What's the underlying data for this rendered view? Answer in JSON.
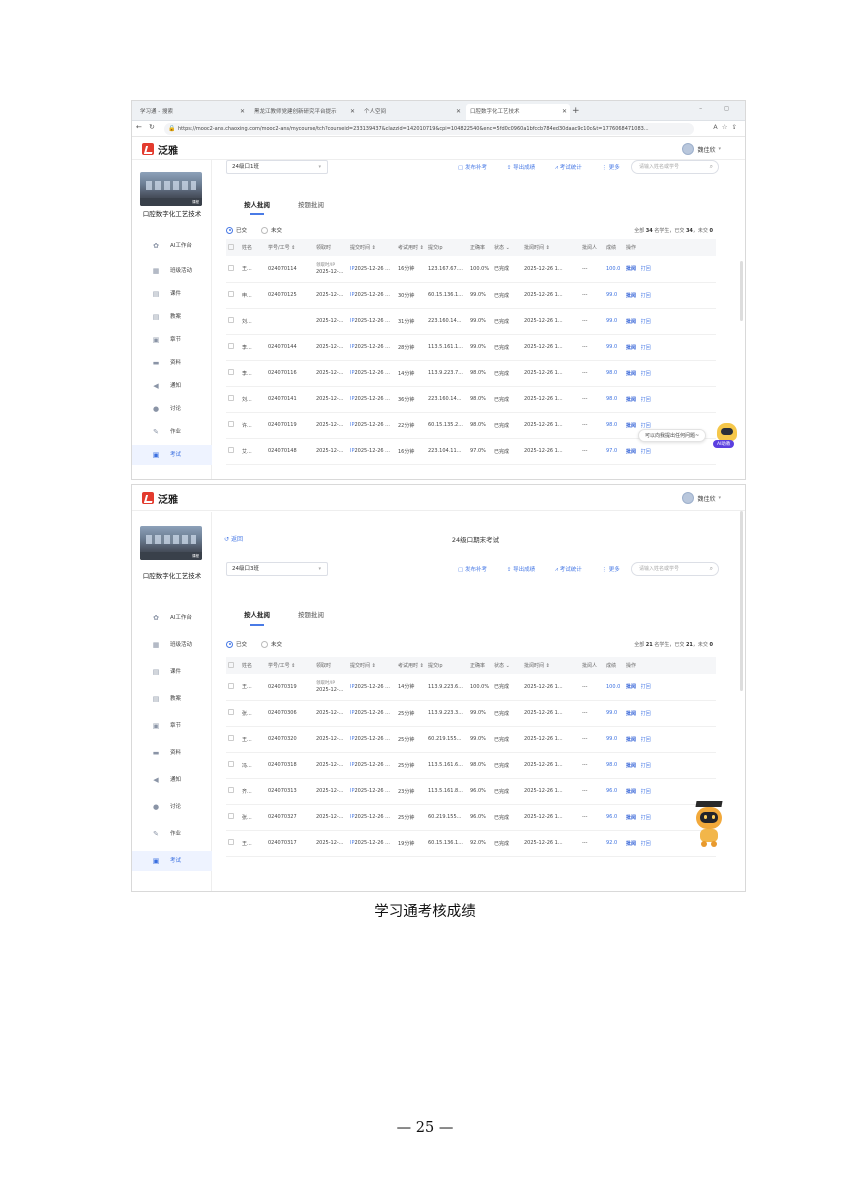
{
  "browser": {
    "tabs": [
      "学习通 - 搜索",
      "黑龙江教师党建创新研究平台提示",
      "个人空间",
      "口腔数字化工艺技术"
    ],
    "url": "https://mooc2-ans.chaoxing.com/mooc2-ans/mycourse/tch?courseid=233139437&clazzid=142010719&cpi=104822540&enc=5fd0c0960a1bfccb784ed30daac9c10c&t=1776068471083..."
  },
  "app": {
    "brand": "泛雅",
    "user": "魏佳欣"
  },
  "sidebar": {
    "course_name": "口腔数字化工艺技术",
    "cover_badge": "课程",
    "items": [
      {
        "label": "AI工作台",
        "icon": "star-icon"
      },
      {
        "label": "班级活动",
        "icon": "grid-icon"
      },
      {
        "label": "课件",
        "icon": "file-icon"
      },
      {
        "label": "教案",
        "icon": "doc-icon"
      },
      {
        "label": "章节",
        "icon": "chapter-icon"
      },
      {
        "label": "资料",
        "icon": "folder-icon"
      },
      {
        "label": "通知",
        "icon": "speaker-icon"
      },
      {
        "label": "讨论",
        "icon": "chat-icon"
      },
      {
        "label": "作业",
        "icon": "pencil-icon"
      },
      {
        "label": "考试",
        "icon": "exam-icon"
      }
    ]
  },
  "labels": {
    "back": "返回",
    "tab_person": "按人批阅",
    "tab_question": "按题批阅",
    "submitted": "已交",
    "not_submitted": "未交",
    "search_placeholder": "请输入姓名或学号",
    "actions": [
      "发布补考",
      "导出成绩",
      "考试统计",
      "更多"
    ],
    "columns": [
      "姓名",
      "学号/工号",
      "领取时",
      "提交时间",
      "考试用时",
      "提交ip",
      "正确率",
      "状态",
      "批阅时间",
      "批阅人",
      "成绩",
      "操作"
    ],
    "ipsub": "IP",
    "op_review": "批阅",
    "op_return": "打回"
  },
  "panel1": {
    "class_name": "24级口1班",
    "summary_total": "34",
    "summary_sub": "34",
    "summary_unsub": "0",
    "rows": [
      {
        "name": "王...",
        "id": "024070114",
        "take": "2025-12-...",
        "submit": "2025-12-26 ...",
        "duration": "16分钟",
        "ip": "123.167.67....",
        "rate": "100.0%",
        "status": "已完成",
        "rtime": "2025-12-26 1...",
        "reviewer": "---",
        "score": "100.0"
      },
      {
        "name": "申...",
        "id": "024070125",
        "take": "2025-12-...",
        "submit": "2025-12-26 ...",
        "duration": "30分钟",
        "ip": "60.15.136.1...",
        "rate": "99.0%",
        "status": "已完成",
        "rtime": "2025-12-26 1...",
        "reviewer": "---",
        "score": "99.0"
      },
      {
        "name": "刘...",
        "id": "",
        "take": "2025-12-...",
        "submit": "2025-12-26 ...",
        "duration": "31分钟",
        "ip": "223.160.14...",
        "rate": "99.0%",
        "status": "已完成",
        "rtime": "2025-12-26 1...",
        "reviewer": "---",
        "score": "99.0"
      },
      {
        "name": "李...",
        "id": "024070144",
        "take": "2025-12-...",
        "submit": "2025-12-26 ...",
        "duration": "28分钟",
        "ip": "113.5.161.1...",
        "rate": "99.0%",
        "status": "已完成",
        "rtime": "2025-12-26 1...",
        "reviewer": "---",
        "score": "99.0"
      },
      {
        "name": "李...",
        "id": "024070116",
        "take": "2025-12-...",
        "submit": "2025-12-26 ...",
        "duration": "14分钟",
        "ip": "113.9.223.7...",
        "rate": "98.0%",
        "status": "已完成",
        "rtime": "2025-12-26 1...",
        "reviewer": "---",
        "score": "98.0"
      },
      {
        "name": "刘...",
        "id": "024070141",
        "take": "2025-12-...",
        "submit": "2025-12-26 ...",
        "duration": "36分钟",
        "ip": "223.160.14...",
        "rate": "98.0%",
        "status": "已完成",
        "rtime": "2025-12-26 1...",
        "reviewer": "---",
        "score": "98.0"
      },
      {
        "name": "许...",
        "id": "024070119",
        "take": "2025-12-...",
        "submit": "2025-12-26 ...",
        "duration": "22分钟",
        "ip": "60.15.135.2...",
        "rate": "98.0%",
        "status": "已完成",
        "rtime": "2025-12-26 1...",
        "reviewer": "---",
        "score": "98.0"
      },
      {
        "name": "艾...",
        "id": "024070148",
        "take": "2025-12-...",
        "submit": "2025-12-26 ...",
        "duration": "16分钟",
        "ip": "223.104.11...",
        "rate": "97.0%",
        "status": "已完成",
        "rtime": "2025-12-26 1...",
        "reviewer": "---",
        "score": "97.0"
      }
    ]
  },
  "panel2": {
    "exam_title": "24级口期末考试",
    "class_name": "24级口3班",
    "summary_total": "21",
    "summary_sub": "21",
    "summary_unsub": "0",
    "rows": [
      {
        "name": "王...",
        "id": "024070319",
        "take": "2025-12-...",
        "submit": "2025-12-26 ...",
        "duration": "14分钟",
        "ip": "113.9.223.6...",
        "rate": "100.0%",
        "status": "已完成",
        "rtime": "2025-12-26 1...",
        "reviewer": "---",
        "score": "100.0"
      },
      {
        "name": "张...",
        "id": "024070306",
        "take": "2025-12-...",
        "submit": "2025-12-26 ...",
        "duration": "25分钟",
        "ip": "113.9.223.3...",
        "rate": "99.0%",
        "status": "已完成",
        "rtime": "2025-12-26 1...",
        "reviewer": "---",
        "score": "99.0"
      },
      {
        "name": "王...",
        "id": "024070320",
        "take": "2025-12-...",
        "submit": "2025-12-26 ...",
        "duration": "25分钟",
        "ip": "60.219.155...",
        "rate": "99.0%",
        "status": "已完成",
        "rtime": "2025-12-26 1...",
        "reviewer": "---",
        "score": "99.0"
      },
      {
        "name": "冯...",
        "id": "024070318",
        "take": "2025-12-...",
        "submit": "2025-12-26 ...",
        "duration": "25分钟",
        "ip": "113.5.161.6...",
        "rate": "98.0%",
        "status": "已完成",
        "rtime": "2025-12-26 1...",
        "reviewer": "---",
        "score": "98.0"
      },
      {
        "name": "齐...",
        "id": "024070313",
        "take": "2025-12-...",
        "submit": "2025-12-26 ...",
        "duration": "23分钟",
        "ip": "113.5.161.8...",
        "rate": "96.0%",
        "status": "已完成",
        "rtime": "2025-12-26 1...",
        "reviewer": "---",
        "score": "96.0"
      },
      {
        "name": "张...",
        "id": "024070327",
        "take": "2025-12-...",
        "submit": "2025-12-26 ...",
        "duration": "25分钟",
        "ip": "60.219.155...",
        "rate": "96.0%",
        "status": "已完成",
        "rtime": "2025-12-26 1...",
        "reviewer": "---",
        "score": "96.0"
      },
      {
        "name": "王...",
        "id": "024070317",
        "take": "2025-12-...",
        "submit": "2025-12-26 ...",
        "duration": "19分钟",
        "ip": "60.15.136.1...",
        "rate": "92.0%",
        "status": "已完成",
        "rtime": "2025-12-26 1...",
        "reviewer": "---",
        "score": "92.0"
      }
    ]
  },
  "ai": {
    "bubble": "可以向我提出任何问题~",
    "badge": "AI助教"
  },
  "caption": "学习通考核成绩",
  "page_number": "— 25 —",
  "colors": {
    "accent": "#4a7be6",
    "brand": "#e33b2e"
  }
}
